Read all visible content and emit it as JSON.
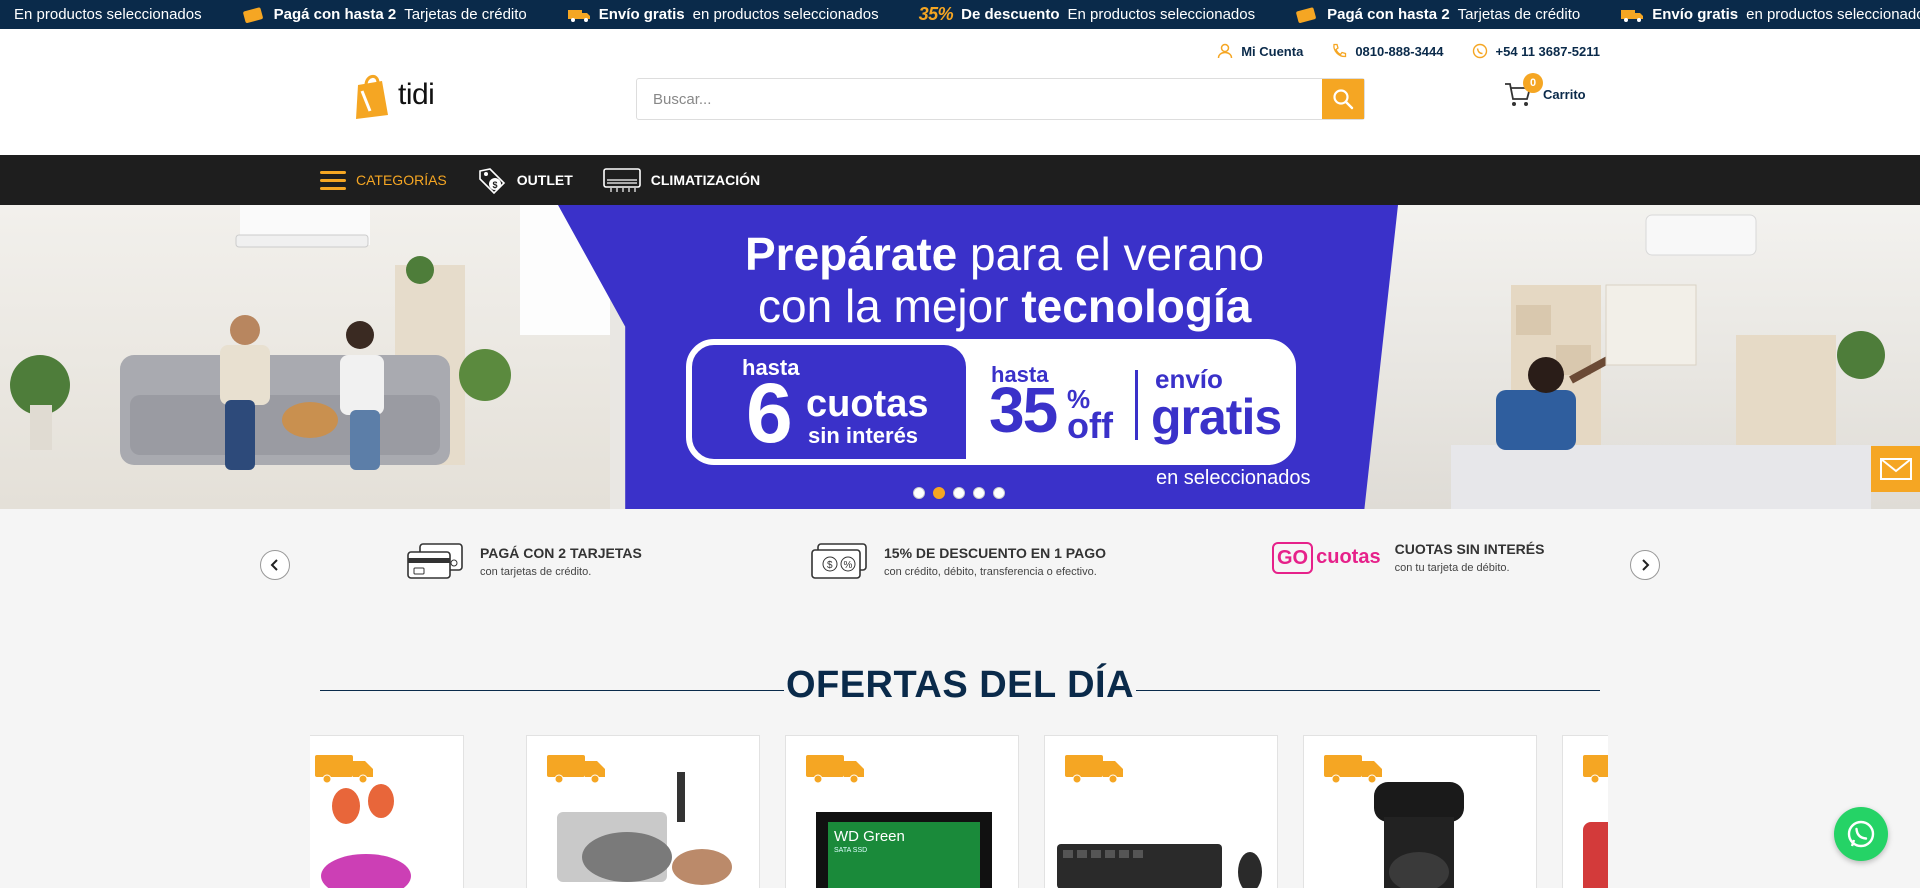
{
  "ticker": [
    {
      "icon": "truck-icon",
      "bold": "",
      "text": "En productos seleccionados"
    },
    {
      "icon": "card-icon",
      "bold": "Pagá con hasta 2",
      "text": "Tarjetas de crédito"
    },
    {
      "icon": "truck-icon",
      "bold": "Envío gratis",
      "text": "en productos seleccionados"
    },
    {
      "icon": "discount-35-icon",
      "disc": "35%",
      "bold": "De descuento",
      "text": "En productos seleccionados"
    },
    {
      "icon": "card-icon",
      "bold": "Pagá con hasta 2",
      "text": "Tarjetas de crédito"
    },
    {
      "icon": "truck-icon",
      "bold": "Envío gratis",
      "text": "en productos seleccionados"
    }
  ],
  "header": {
    "logo_text": "tidi",
    "account": "Mi Cuenta",
    "phone": "0810-888-3444",
    "whatsapp": "+54 11 3687-5211",
    "search_placeholder": "Buscar...",
    "cart_count": "0",
    "cart_label": "Carrito"
  },
  "nav": {
    "categories": "CATEGORÍAS",
    "outlet": "OUTLET",
    "climatizacion": "CLIMATIZACIÓN"
  },
  "hero": {
    "title1_bold": "Prepárate",
    "title1_rest": " para el verano",
    "title2_rest": "con la mejor ",
    "title2_bold": "tecnología",
    "hasta": "hasta",
    "six": "6",
    "cuotas": "cuotas",
    "sin_interes": "sin interés",
    "hasta2": "hasta",
    "thirty_five": "35",
    "pct": "%",
    "off": "off",
    "envio": "envío",
    "gratis": "gratis",
    "seleccionados": "en seleccionados",
    "active_slide": 2,
    "slides": 5
  },
  "benefits": [
    {
      "icon": "credit-cards-icon",
      "title": "PAGÁ CON 2 TARJETAS",
      "sub": "con tarjetas de crédito."
    },
    {
      "icon": "cash-discount-icon",
      "title": "15% DE DESCUENTO EN 1 PAGO",
      "sub": "con crédito, débito, transferencia o efectivo."
    },
    {
      "icon": "gocuotas-logo",
      "logo_go": "GO",
      "logo_cuotas": "cuotas",
      "title": "CUOTAS SIN INTERÉS",
      "sub": "con tu tarjeta de débito."
    }
  ],
  "ofertas": {
    "title": "OFERTAS DEL DÍA",
    "badge_text": "Envío gratis"
  },
  "products": [
    {
      "name": "earbuds-image",
      "color": "#e8663a"
    },
    {
      "name": "cookware-set-image",
      "color": "#8a8a8a"
    },
    {
      "name": "ssd-image",
      "color": "#1a7a3a",
      "label": "WD Green",
      "sublabel": "SATA SSD"
    },
    {
      "name": "keyboard-mouse-image",
      "color": "#2a2a2a"
    },
    {
      "name": "coffee-maker-image",
      "color": "#1a1a1a"
    },
    {
      "name": "thermos-image",
      "color": "#d33a3a"
    }
  ],
  "colors": {
    "accent": "#f5a623",
    "navy": "#0a2a4a",
    "hero_blue": "#3a31c9",
    "nav_bg": "#1e1e1e"
  }
}
